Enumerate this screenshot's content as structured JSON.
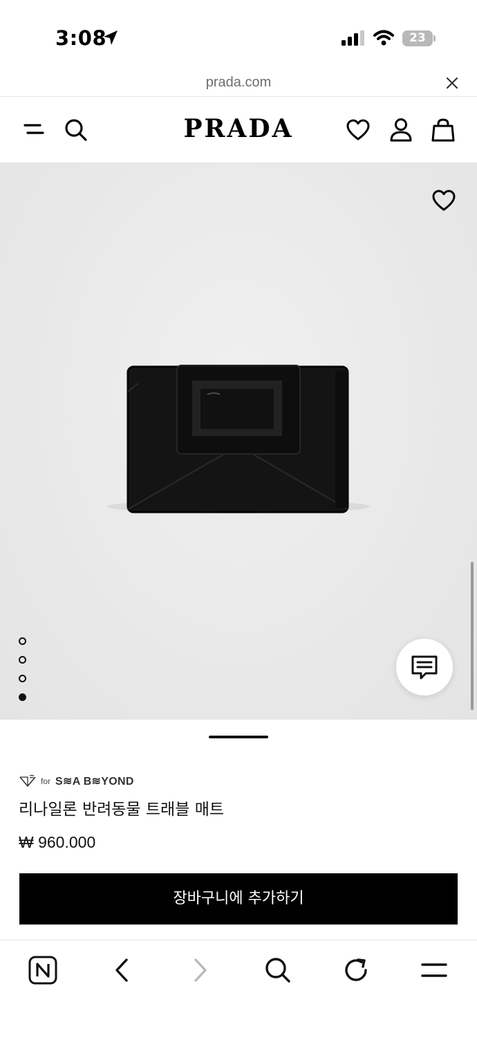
{
  "status_bar": {
    "time": "3:08",
    "battery": "23"
  },
  "url_bar": {
    "url": "prada.com"
  },
  "header": {
    "logo": "PRADA"
  },
  "gallery": {
    "image_count": 4,
    "active_index": 4
  },
  "product": {
    "badge_for": "for",
    "badge_name": "S≋A B≋YOND",
    "name": "리나일론 반려동물 트래블 매트",
    "price": "₩ 960.000",
    "add_to_cart": "장바구니에 추가하기"
  },
  "colors": {
    "accent": "#000000",
    "gallery_bg": "#e9e9e9",
    "muted_text": "#6d6d6d"
  },
  "icons": {
    "status": [
      "location-arrow-icon",
      "cellular-signal-icon",
      "wifi-icon",
      "battery-icon"
    ],
    "header": [
      "menu-icon",
      "search-icon",
      "wishlist-heart-icon",
      "account-icon",
      "shopping-bag-icon"
    ],
    "browser": [
      "naver-home-icon",
      "back-icon",
      "forward-icon",
      "search-icon",
      "reload-icon",
      "menu-icon"
    ]
  }
}
